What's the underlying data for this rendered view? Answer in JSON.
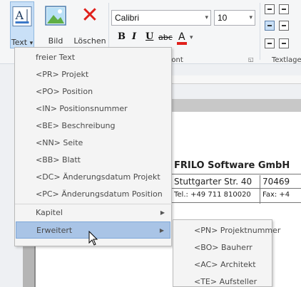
{
  "ribbon": {
    "text_button_label": "Text",
    "text_button_arrow": "▾",
    "bild_button_label": "Bild",
    "loeschen_button_label": "Löschen",
    "loeschen_glyph": "✕",
    "font_name": "Calibri",
    "font_size": "10",
    "dropdown_arrow": "▾",
    "bold": "B",
    "italic": "I",
    "underline": "U",
    "strike": "abc",
    "font_color_glyph": "A",
    "font_color": "#e0201b",
    "group_font": "Font",
    "group_textlage": "Textlage",
    "launcher_glyph": "◱"
  },
  "text_menu": {
    "items": [
      {
        "label": "freier Text"
      },
      {
        "label": "<PR> Projekt"
      },
      {
        "label": "<PO> Position"
      },
      {
        "label": "<IN> Positionsnummer"
      },
      {
        "label": "<BE> Beschreibung"
      },
      {
        "label": "<NN> Seite"
      },
      {
        "label": "<BB> Blatt"
      },
      {
        "label": "<DC> Änderungsdatum Projekt"
      },
      {
        "label": "<PC> Änderungsdatum Position"
      },
      {
        "label": "Kapitel",
        "submenu_arrow": "▶"
      },
      {
        "label": "Erweitert",
        "submenu_arrow": "▶",
        "highlighted": true
      }
    ]
  },
  "sub_menu": {
    "items": [
      {
        "label": "<PN> Projektnummer"
      },
      {
        "label": "<BO> Bauherr"
      },
      {
        "label": "<AC> Architekt"
      },
      {
        "label": "<TE> Aufsteller"
      }
    ]
  },
  "document": {
    "company_name": "FRILO Software GmbH",
    "rows": [
      [
        "Stuttgarter Str. 40",
        "70469"
      ],
      [
        "Tel.: +49 711 810020",
        "Fax: +4"
      ]
    ]
  },
  "colors": {
    "highlight": "#a9c4e6",
    "selected_button": "#c9e0f7",
    "delete_red": "#e0201b"
  }
}
